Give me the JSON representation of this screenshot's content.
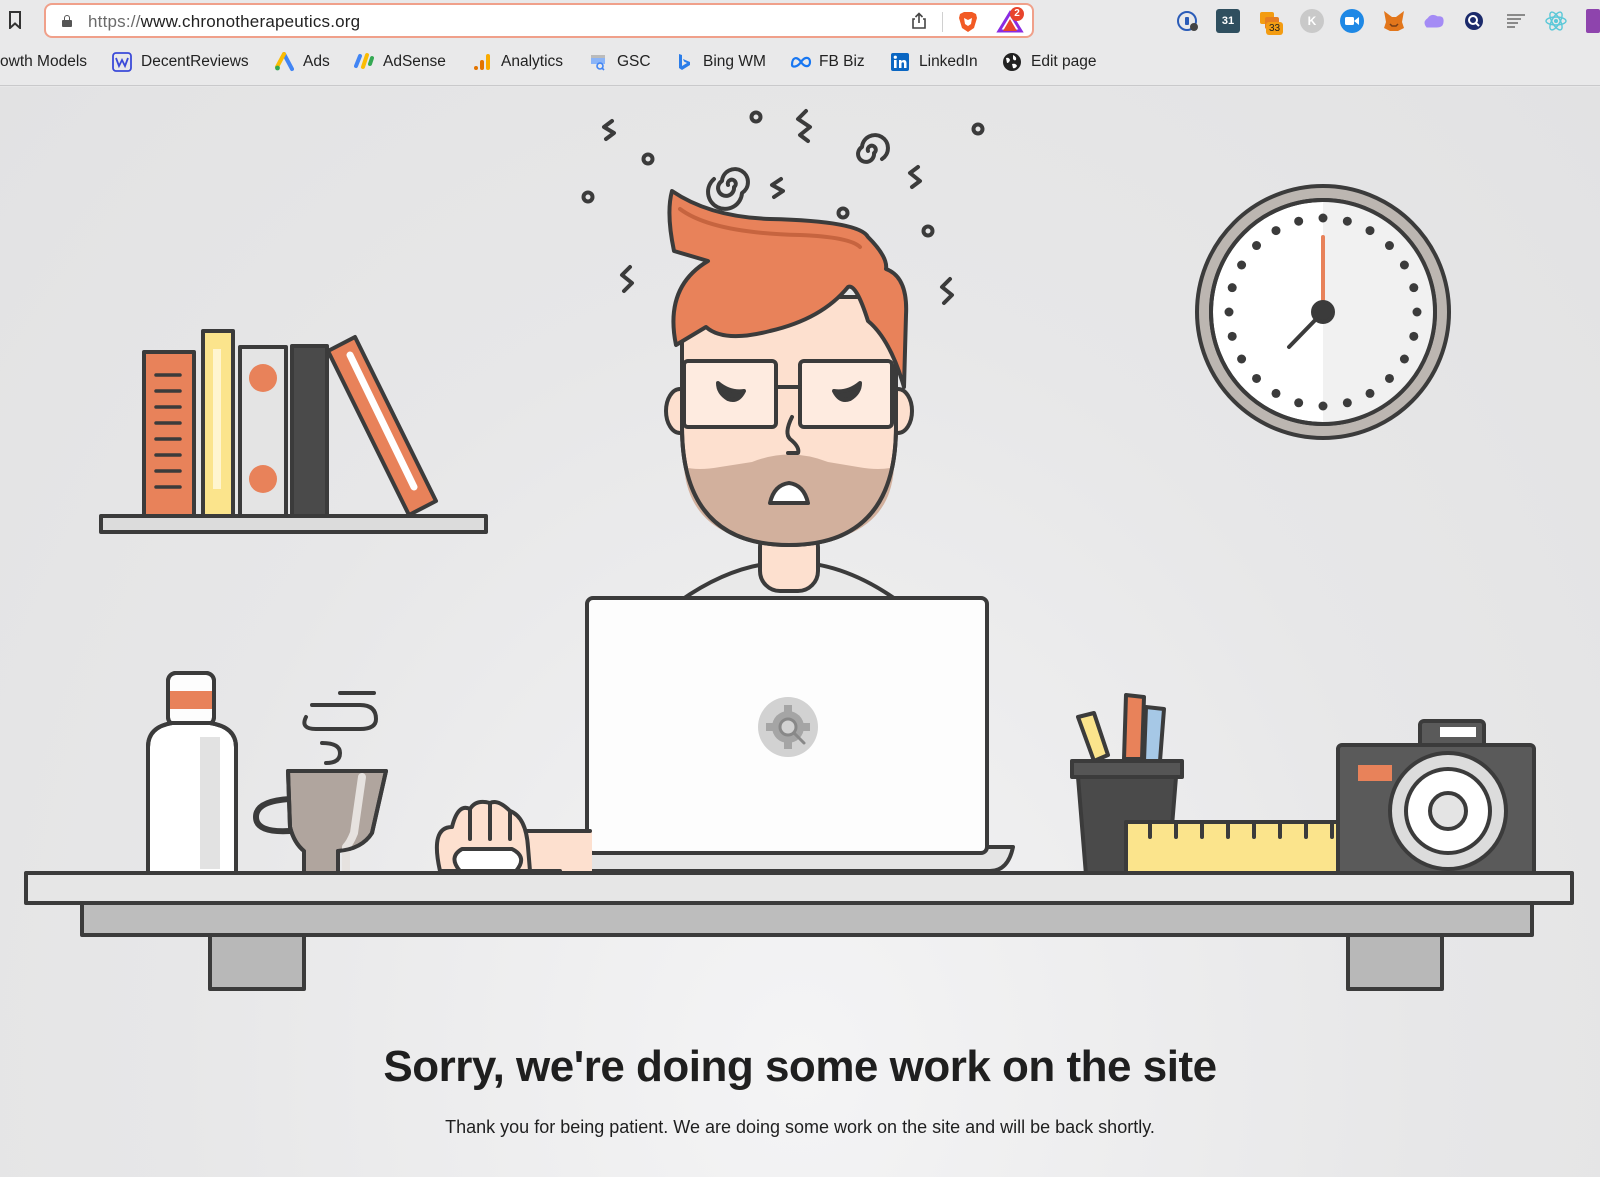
{
  "browser": {
    "url_scheme": "https://",
    "url_host": "www.chronotherapeutics.org",
    "rewards_count": "2",
    "extensions": [
      {
        "name": "password-manager-icon",
        "label": ""
      },
      {
        "name": "calendar-extension-icon",
        "label": "31"
      },
      {
        "name": "tabs-extension-icon",
        "label": ""
      },
      {
        "name": "k-extension-icon",
        "label": "K"
      },
      {
        "name": "video-extension-icon",
        "label": ""
      },
      {
        "name": "metamask-fox-icon",
        "label": ""
      },
      {
        "name": "cloud-extension-icon",
        "label": ""
      },
      {
        "name": "search-extension-icon",
        "label": ""
      },
      {
        "name": "lines-extension-icon",
        "label": ""
      },
      {
        "name": "react-atom-icon",
        "label": ""
      }
    ],
    "extension_badge": "33"
  },
  "bookmarks": [
    {
      "label": "owth Models",
      "icon": "none"
    },
    {
      "label": "DecentReviews",
      "icon": "w-logo-icon"
    },
    {
      "label": "Ads",
      "icon": "google-ads-icon"
    },
    {
      "label": "AdSense",
      "icon": "adsense-icon"
    },
    {
      "label": "Analytics",
      "icon": "analytics-icon"
    },
    {
      "label": "GSC",
      "icon": "search-console-icon"
    },
    {
      "label": "Bing WM",
      "icon": "bing-icon"
    },
    {
      "label": "FB Biz",
      "icon": "meta-icon"
    },
    {
      "label": "LinkedIn",
      "icon": "linkedin-icon"
    },
    {
      "label": "Edit page",
      "icon": "globe-icon"
    }
  ],
  "page": {
    "headline": "Sorry, we're doing some work on the site",
    "subtext": "Thank you for being patient. We are doing some work on the site and will be back shortly."
  },
  "colors": {
    "accent_orange": "#e8825a",
    "outline": "#3b3b3b",
    "skin": "#fde0cf",
    "desk": "#dcdcdc"
  }
}
